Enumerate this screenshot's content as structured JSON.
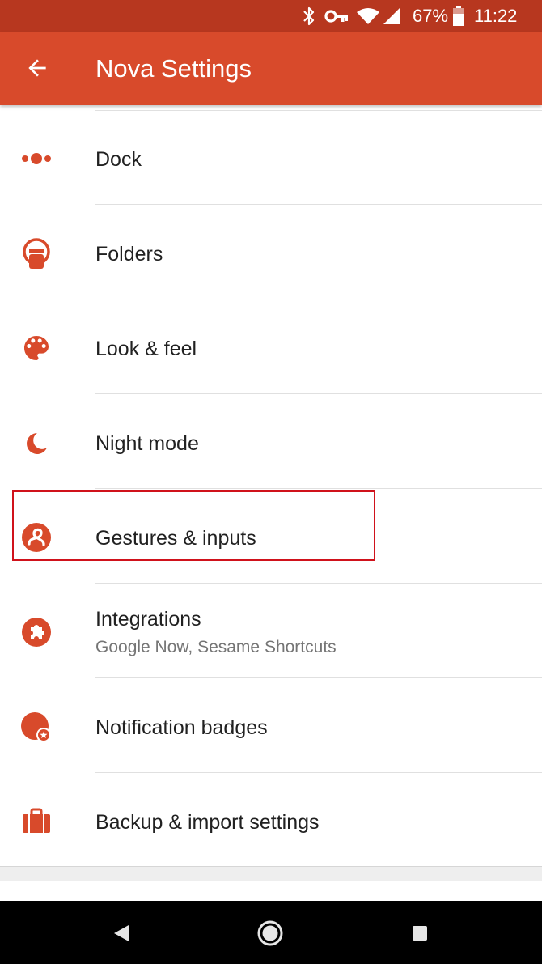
{
  "status_bar": {
    "battery": "67%",
    "time": "11:22",
    "icons": [
      "bluetooth-icon",
      "vpn-key-icon",
      "wifi-icon",
      "cell-signal-icon",
      "battery-icon"
    ]
  },
  "app_bar": {
    "title": "Nova Settings",
    "back_icon": "arrow-back-icon"
  },
  "settings": {
    "items": [
      {
        "label": "Dock",
        "icon": "dock-icon"
      },
      {
        "label": "Folders",
        "icon": "folder-icon"
      },
      {
        "label": "Look & feel",
        "icon": "palette-icon"
      },
      {
        "label": "Night mode",
        "icon": "moon-icon"
      },
      {
        "label": "Gestures & inputs",
        "icon": "gesture-icon"
      },
      {
        "label": "Integrations",
        "subtitle": "Google Now, Sesame Shortcuts",
        "icon": "puzzle-icon"
      },
      {
        "label": "Notification badges",
        "icon": "badge-icon"
      },
      {
        "label": "Backup & import settings",
        "icon": "briefcase-icon"
      }
    ]
  },
  "colors": {
    "accent": "#d84a2b",
    "status_bar": "#b7371f",
    "highlight_border": "#d0121b"
  },
  "nav_bar": {
    "icons": [
      "nav-back-icon",
      "nav-home-icon",
      "nav-recents-icon"
    ]
  }
}
